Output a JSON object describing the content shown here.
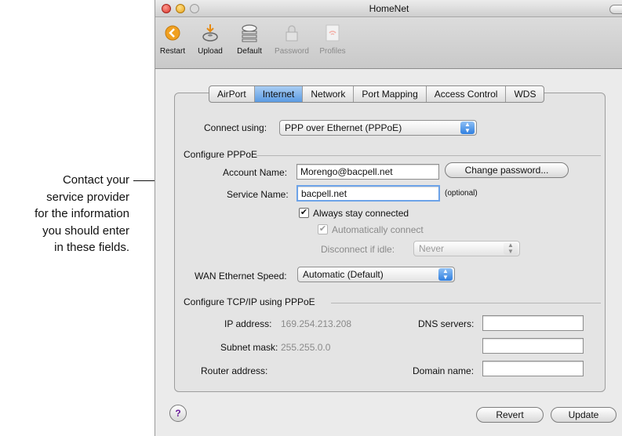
{
  "callout": {
    "lines": [
      "Contact your",
      "service provider",
      "for the information",
      "you should enter",
      "in these fields."
    ]
  },
  "window": {
    "title": "HomeNet"
  },
  "toolbar": {
    "items": [
      {
        "label": "Restart",
        "icon": "restart-icon",
        "enabled": true
      },
      {
        "label": "Upload",
        "icon": "upload-icon",
        "enabled": true
      },
      {
        "label": "Default",
        "icon": "default-icon",
        "enabled": true
      },
      {
        "label": "Password",
        "icon": "lock-icon",
        "enabled": false
      },
      {
        "label": "Profiles",
        "icon": "profiles-icon",
        "enabled": false
      }
    ]
  },
  "tabs": [
    "AirPort",
    "Internet",
    "Network",
    "Port Mapping",
    "Access Control",
    "WDS"
  ],
  "selected_tab": "Internet",
  "connect": {
    "label": "Connect using:",
    "value": "PPP over Ethernet (PPPoE)"
  },
  "pppoe": {
    "section": "Configure PPPoE",
    "account_label": "Account Name:",
    "account_value": "Morengo@bacpell.net",
    "change_password": "Change password...",
    "service_label": "Service Name:",
    "service_value": "bacpell.net",
    "optional": "(optional)",
    "always_connected": "Always stay connected",
    "auto_connect": "Automatically connect",
    "disconnect_label": "Disconnect if idle:",
    "disconnect_value": "Never"
  },
  "wan": {
    "label": "WAN Ethernet Speed:",
    "value": "Automatic (Default)"
  },
  "tcpip": {
    "section": "Configure TCP/IP using PPPoE",
    "ip_label": "IP address:",
    "ip_value": "169.254.213.208",
    "subnet_label": "Subnet mask:",
    "subnet_value": "255.255.0.0",
    "router_label": "Router address:",
    "dns_label": "DNS servers:",
    "domain_label": "Domain name:"
  },
  "footer": {
    "help": "?",
    "revert": "Revert",
    "update": "Update"
  },
  "colors": {
    "accent": "#5b9be3",
    "close": "#e0453c",
    "minimize": "#f2b32d",
    "restart": "#f0a020"
  }
}
